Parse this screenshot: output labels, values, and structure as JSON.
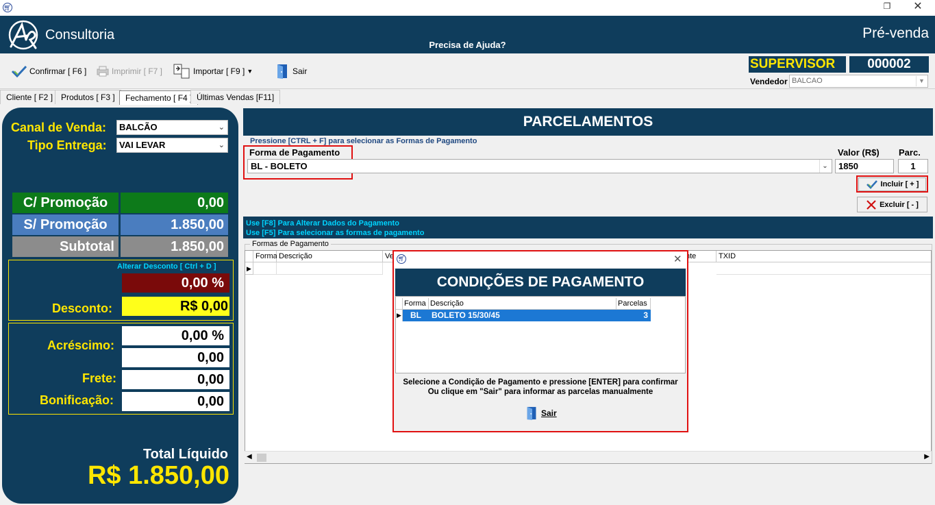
{
  "window": {
    "restore_glyph": "❐",
    "close_glyph": "✕"
  },
  "header": {
    "brand": "Consultoria",
    "help": "Precisa de Ajuda?",
    "module": "Pré-venda"
  },
  "toolbar": {
    "confirm": "Confirmar [ F6 ]",
    "print": "Imprimir  [ F7 ]",
    "import": "Importar [ F9 ]",
    "exit": "Sair",
    "role": "SUPERVISOR",
    "code": "000002",
    "seller_label": "Vendedor",
    "seller_value": "BALCAO"
  },
  "tabs": [
    {
      "label": "Cliente [ F2 ]"
    },
    {
      "label": "Produtos [ F3 ]"
    },
    {
      "label": "Fechamento [ F4 ]",
      "active": true
    },
    {
      "label": "Últimas Vendas [F11]"
    }
  ],
  "left": {
    "channel_label": "Canal de Venda:",
    "channel_value": "BALCÃO",
    "delivery_label": "Tipo Entrega:",
    "delivery_value": "VAI LEVAR",
    "promo_label": "C/ Promoção",
    "promo_value": "0,00",
    "nopromo_label": "S/ Promoção",
    "nopromo_value": "1.850,00",
    "subtotal_label": "Subtotal",
    "subtotal_value": "1.850,00",
    "discount_hint": "Alterar Desconto  [ Ctrl + D ]",
    "discount_pct": "0,00 %",
    "discount_label": "Desconto:",
    "discount_value": "R$ 0,00",
    "surcharge_label": "Acréscimo:",
    "surcharge_pct": "0,00 %",
    "surcharge_value": "0,00",
    "freight_label": "Frete:",
    "freight_value": "0,00",
    "bonus_label": "Bonificação:",
    "bonus_value": "0,00",
    "total_label": "Total Líquido",
    "total_value": "R$ 1.850,00"
  },
  "parcelamentos": {
    "title": "PARCELAMENTOS",
    "hint": "Pressione [CTRL + F] para selecionar as Formas de Pagamento",
    "payment_label": "Forma de Pagamento",
    "payment_value": "BL - BOLETO",
    "value_label": "Valor (R$)",
    "value": "1850",
    "parc_label": "Parc.",
    "parc_value": "1",
    "include": "Incluir [ + ]",
    "exclude": "Excluir [ - ]",
    "f8": "Use [F8] Para Alterar Dados do Pagamento",
    "f5": "Use [F5] Para selecionar as formas de pagamento",
    "grid_legend": "Formas de Pagamento",
    "columns": [
      "Forma",
      "Descrição",
      "Ve",
      "nte",
      "TXID"
    ]
  },
  "dialog": {
    "title": "CONDIÇÕES DE PAGAMENTO",
    "columns": [
      "Forma",
      "Descrição",
      "Parcelas"
    ],
    "row": {
      "forma": "BL",
      "descricao": "BOLETO 15/30/45",
      "parcelas": "3"
    },
    "msg1": "Selecione a Condição de Pagamento e pressione [ENTER] para confirmar",
    "msg2": "Ou clique em \"Sair\" para informar as parcelas manualmente",
    "exit": "Sair"
  }
}
